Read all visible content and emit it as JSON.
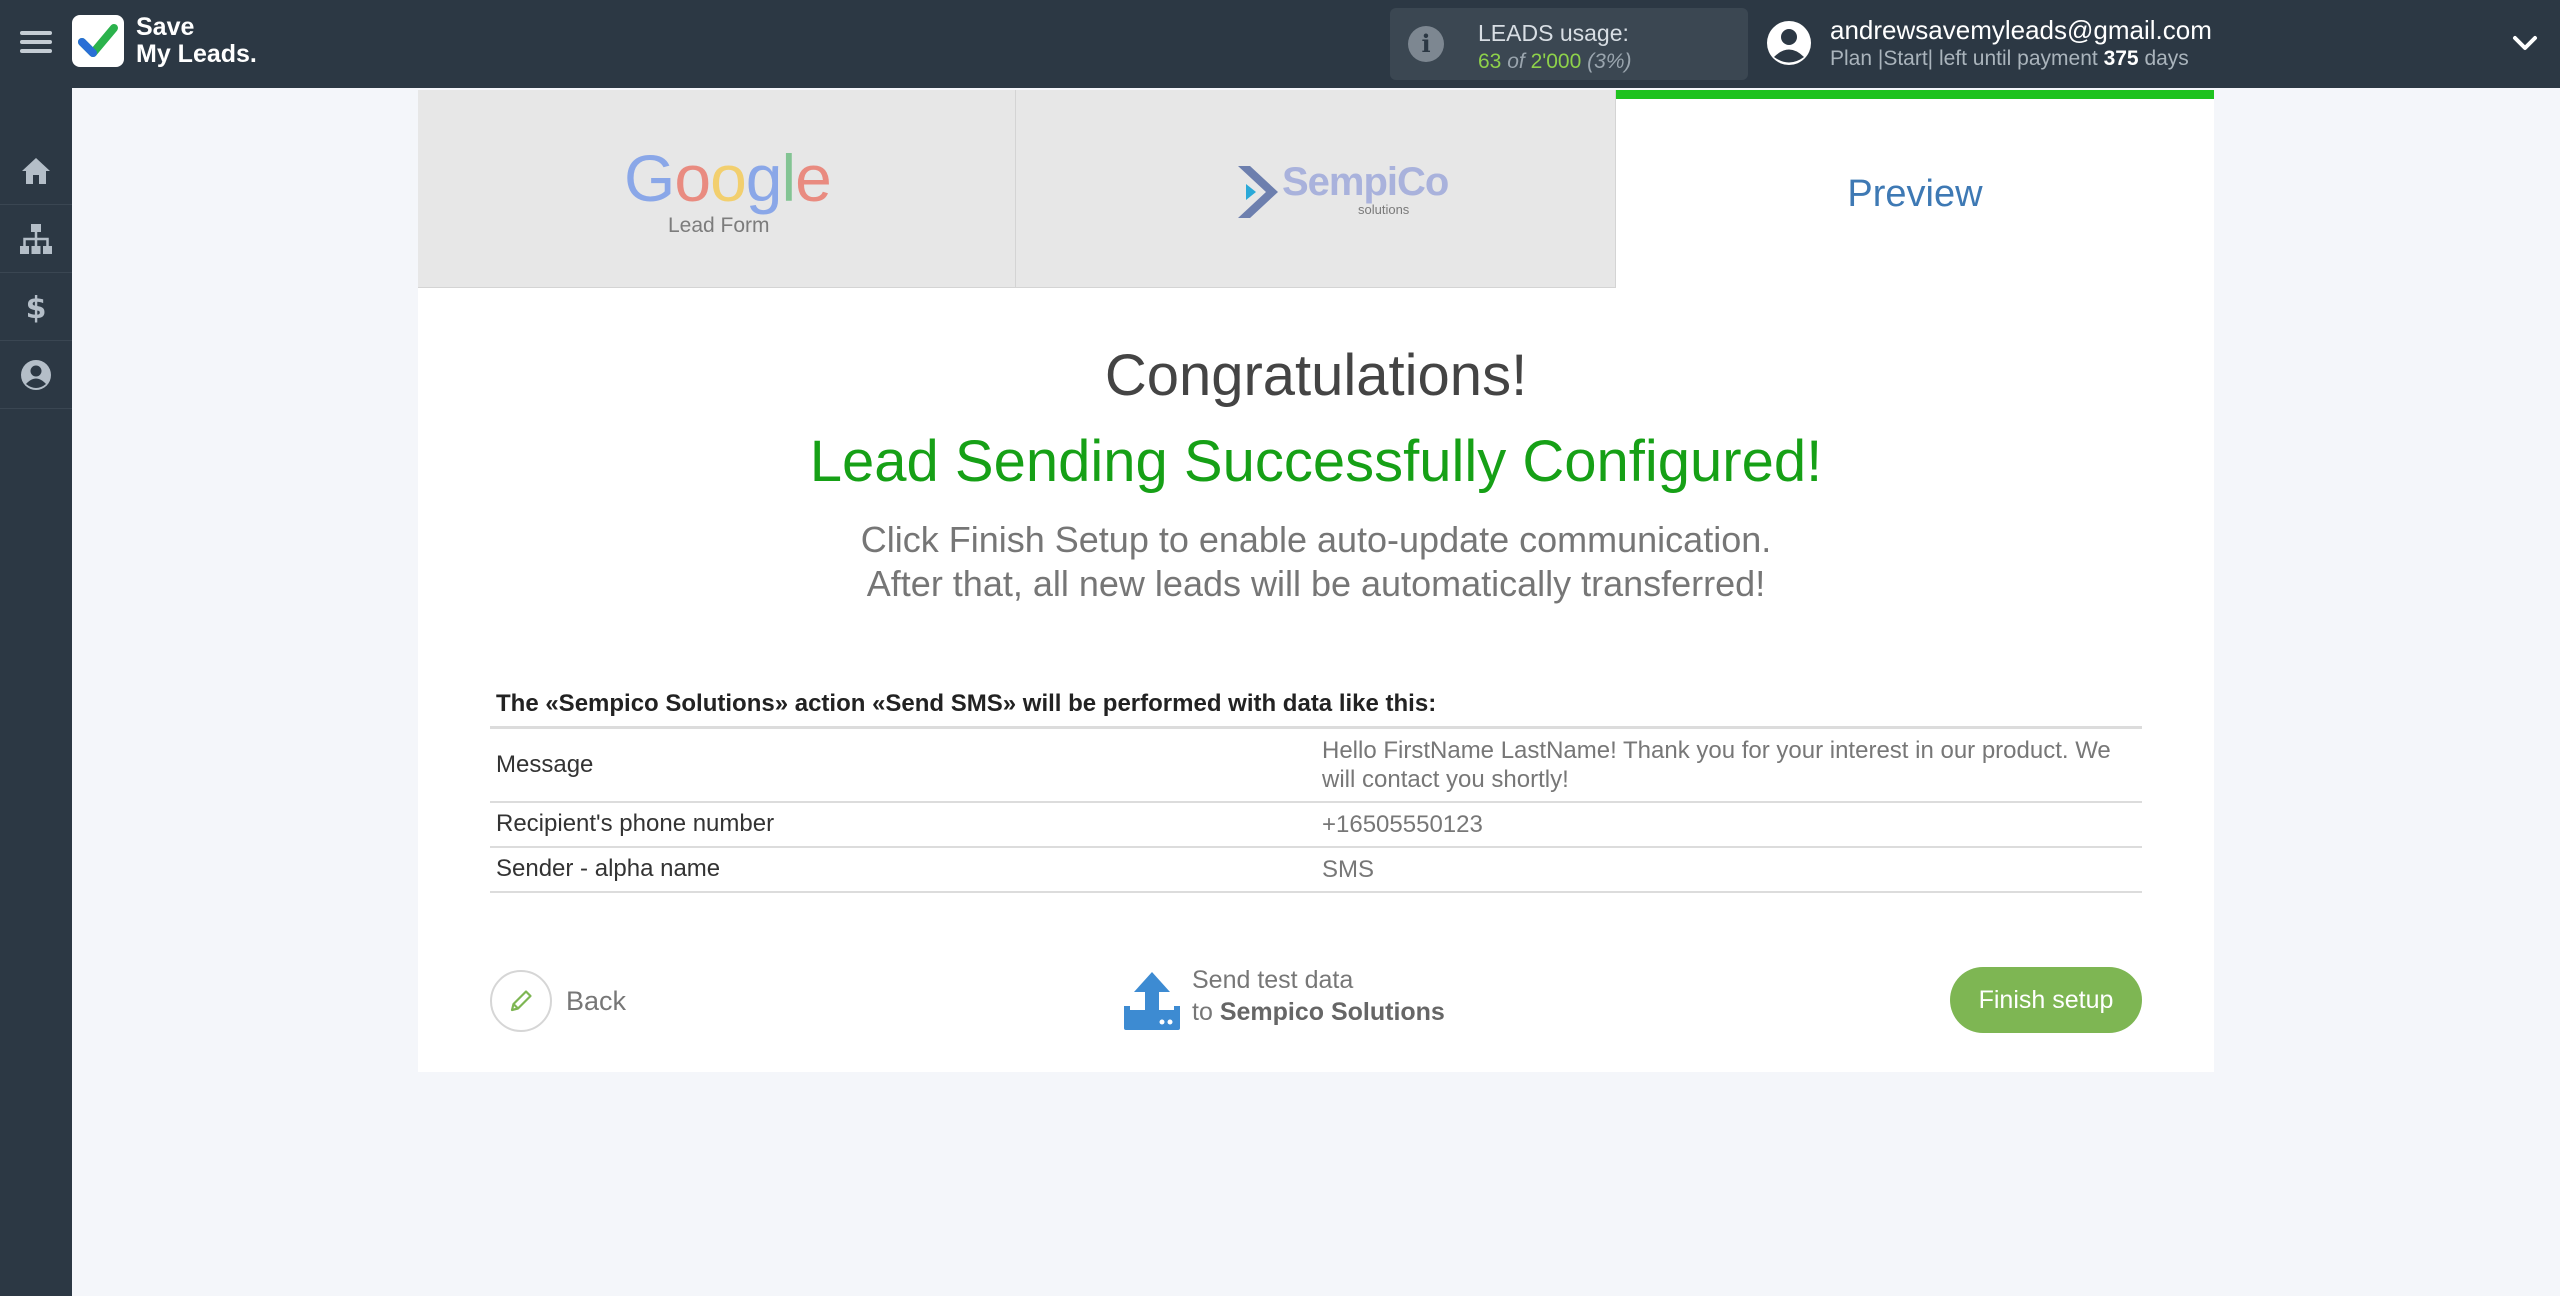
{
  "app": {
    "name_line1": "Save",
    "name_line2": "My Leads."
  },
  "usage": {
    "title": "LEADS usage:",
    "used": "63",
    "of": "of",
    "limit": "2'000",
    "percent": "(3%)"
  },
  "user": {
    "email": "andrewsavemyleads@gmail.com",
    "plan_prefix": "Plan |Start| left until payment",
    "days": "375",
    "days_suffix": "days"
  },
  "steps": {
    "source_logo": "Google",
    "source_sub": "Lead Form",
    "dest_logo": "SempiCo",
    "dest_sub": "solutions",
    "current": "Preview"
  },
  "main": {
    "congrats": "Congratulations!",
    "success": "Lead Sending Successfully Configured!",
    "info_line1": "Click Finish Setup to enable auto-update communication.",
    "info_line2": "After that, all new leads will be automatically transferred!",
    "table_title": "The «Sempico Solutions» action «Send SMS» will be performed with data like this:",
    "rows": [
      {
        "key": "Message",
        "value": "Hello FirstName LastName! Thank you for your interest in our product. We will contact you shortly!"
      },
      {
        "key": "Recipient's phone number",
        "value": "+16505550123"
      },
      {
        "key": "Sender - alpha name",
        "value": "SMS"
      }
    ]
  },
  "actions": {
    "back": "Back",
    "send_line1": "Send test data",
    "send_to": "to",
    "send_target": "Sempico Solutions",
    "finish": "Finish setup"
  },
  "colors": {
    "topbar": "#2c3844",
    "success": "#16a016",
    "progress": "#1ec21e",
    "finish": "#7eb653",
    "preview": "#3e79b4"
  },
  "icons": [
    "menu-icon",
    "logo-check-icon",
    "info-icon",
    "user-avatar-icon",
    "chevron-down-icon",
    "home-icon",
    "sitemap-icon",
    "dollar-icon",
    "account-icon",
    "pencil-icon",
    "upload-icon"
  ]
}
